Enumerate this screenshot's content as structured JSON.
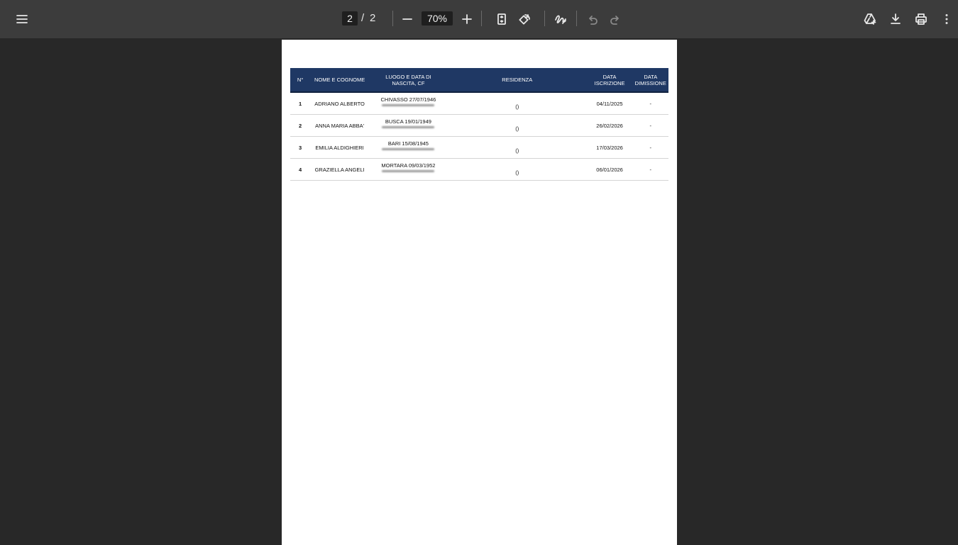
{
  "toolbar": {
    "current_page": "2",
    "separator": "/",
    "total_pages": "2",
    "zoom": "70%"
  },
  "table": {
    "headers": {
      "num": "N°",
      "name": "NOME E COGNOME",
      "birth_line1": "LUOGO E DATA DI",
      "birth_line2": "NASCITA, CF",
      "residence": "RESIDENZA",
      "enroll_line1": "DATA",
      "enroll_line2": "ISCRIZIONE",
      "dismiss_line1": "DATA",
      "dismiss_line2": "DIMISSIONE"
    },
    "rows": [
      {
        "num": "1",
        "name": "ADRIANO ALBERTO",
        "birth": "CHIVASSO 27/07/1946",
        "residence": "()",
        "enrolled": "04/11/2025",
        "dismissed": "-"
      },
      {
        "num": "2",
        "name": "ANNA MARIA ABBA'",
        "birth": "BUSCA 19/01/1949",
        "residence": "()",
        "enrolled": "26/02/2026",
        "dismissed": "-"
      },
      {
        "num": "3",
        "name": "EMILIA ALDIGHIERI",
        "birth": "BARI 15/08/1945",
        "residence": "()",
        "enrolled": "17/03/2026",
        "dismissed": "-"
      },
      {
        "num": "4",
        "name": "GRAZIELLA ANGELI",
        "birth": "MORTARA 09/03/1952",
        "residence": "()",
        "enrolled": "06/01/2026",
        "dismissed": "-"
      }
    ]
  }
}
